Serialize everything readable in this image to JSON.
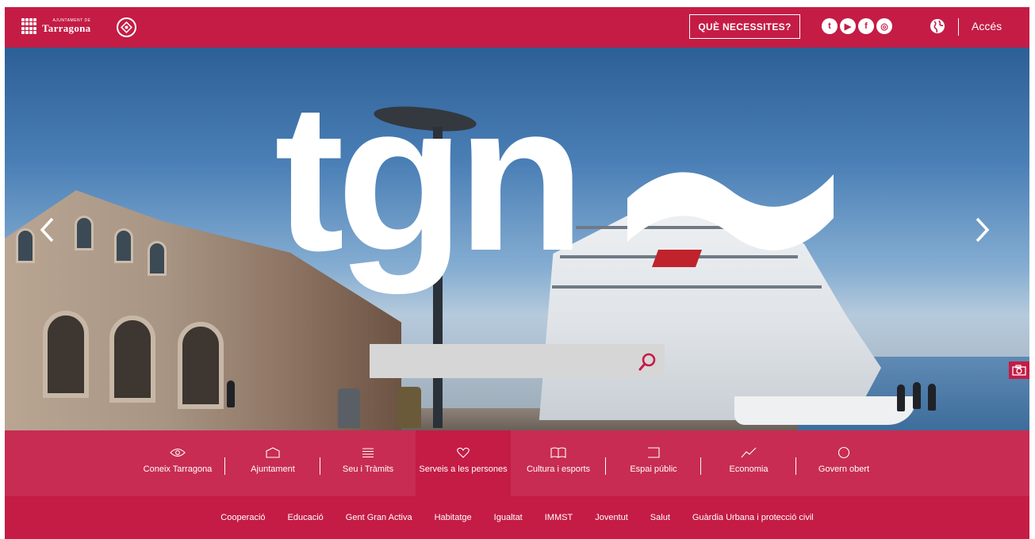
{
  "header": {
    "logo_small": "AJUNTAMENT DE",
    "logo_big": "Tarragona",
    "logo_icon": "tarragona-grid-logo",
    "unesco_icon": "unesco-heritage-icon",
    "need_button": "QUÈ NECESSITES?",
    "socials": [
      {
        "name": "twitter",
        "glyph": "t"
      },
      {
        "name": "youtube",
        "glyph": "▶"
      },
      {
        "name": "facebook",
        "glyph": "f"
      },
      {
        "name": "instagram",
        "glyph": "◎"
      }
    ],
    "globe_icon": "globe-icon",
    "access_label": "Accés"
  },
  "hero": {
    "brand": "tgn",
    "search_placeholder": "",
    "search_icon": "search-icon",
    "prev_icon": "chevron-left-icon",
    "next_icon": "chevron-right-icon",
    "camera_icon": "camera-icon"
  },
  "categories": [
    {
      "label": "Coneix Tarragona",
      "icon": "eye-icon"
    },
    {
      "label": "Ajuntament",
      "icon": "building-icon"
    },
    {
      "label": "Seu i Tràmits",
      "icon": "list-icon"
    },
    {
      "label": "Serveis a les persones",
      "icon": "heart-icon",
      "active": true
    },
    {
      "label": "Cultura i esports",
      "icon": "book-icon"
    },
    {
      "label": "Espai públic",
      "icon": "square-icon"
    },
    {
      "label": "Economia",
      "icon": "trend-icon"
    },
    {
      "label": "Govern obert",
      "icon": "circle-icon"
    }
  ],
  "subnav": [
    "Cooperació",
    "Educació",
    "Gent Gran Activa",
    "Habitatge",
    "Igualtat",
    "IMMST",
    "Joventut",
    "Salut",
    "Guàrdia Urbana i protecció civil"
  ],
  "colors": {
    "brand": "#c41c45",
    "white": "#ffffff"
  }
}
